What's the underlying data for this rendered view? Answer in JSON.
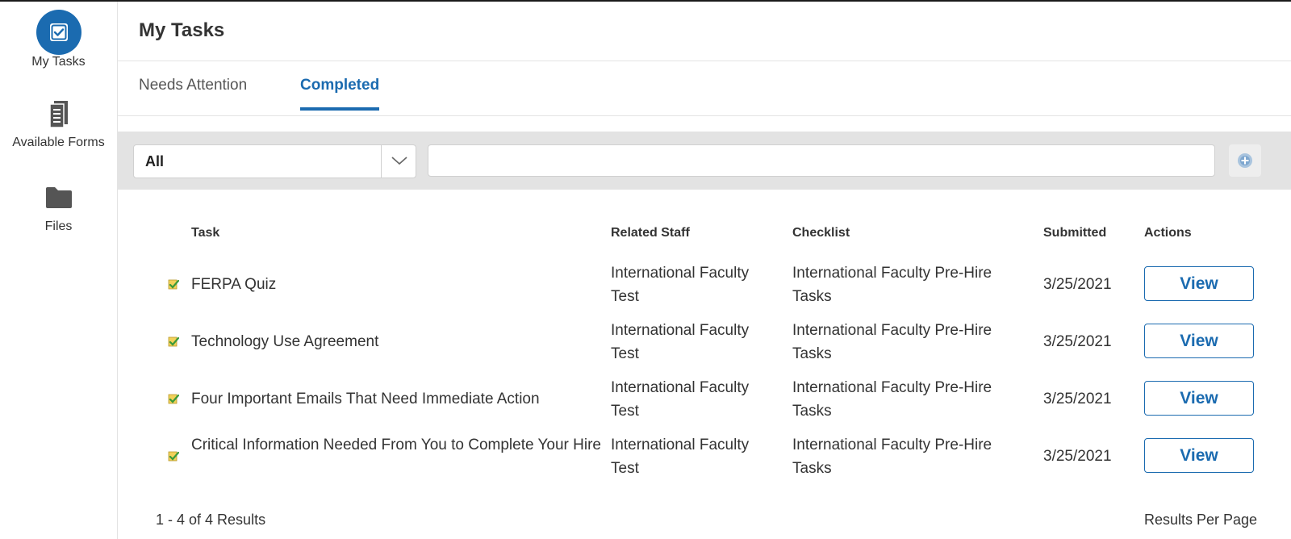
{
  "sidebar": {
    "items": [
      {
        "label": "My Tasks",
        "icon": "checkbox-icon"
      },
      {
        "label": "Available Forms",
        "icon": "document-icon"
      },
      {
        "label": "Files",
        "icon": "folder-icon"
      }
    ],
    "accent_color": "#1b6bb0"
  },
  "header": {
    "title": "My Tasks"
  },
  "tabs": [
    {
      "label": "Needs Attention",
      "active": false
    },
    {
      "label": "Completed",
      "active": true
    }
  ],
  "filter": {
    "selected": "All",
    "search_value": "",
    "add_icon": "plus-circle-icon"
  },
  "table": {
    "columns": [
      "Task",
      "Related Staff",
      "Checklist",
      "Submitted",
      "Actions"
    ],
    "rows": [
      {
        "task": "FERPA Quiz",
        "related_staff": [
          "International Faculty",
          "Test"
        ],
        "checklist": [
          "International Faculty Pre-Hire",
          "Tasks"
        ],
        "submitted": "3/25/2021",
        "action": "View"
      },
      {
        "task": "Technology Use Agreement",
        "related_staff": [
          "International Faculty",
          "Test"
        ],
        "checklist": [
          "International Faculty Pre-Hire",
          "Tasks"
        ],
        "submitted": "3/25/2021",
        "action": "View"
      },
      {
        "task": "Four Important Emails That Need Immediate Action",
        "related_staff": [
          "International Faculty",
          "Test"
        ],
        "checklist": [
          "International Faculty Pre-Hire",
          "Tasks"
        ],
        "submitted": "3/25/2021",
        "action": "View"
      },
      {
        "task": "Critical Information Needed From You to Complete Your Hire",
        "related_staff": [
          "International Faculty",
          "Test"
        ],
        "checklist": [
          "International Faculty Pre-Hire",
          "Tasks"
        ],
        "submitted": "3/25/2021",
        "action": "View"
      }
    ]
  },
  "footer": {
    "results": "1 - 4 of 4 Results",
    "per_page_label": "Results Per Page"
  }
}
